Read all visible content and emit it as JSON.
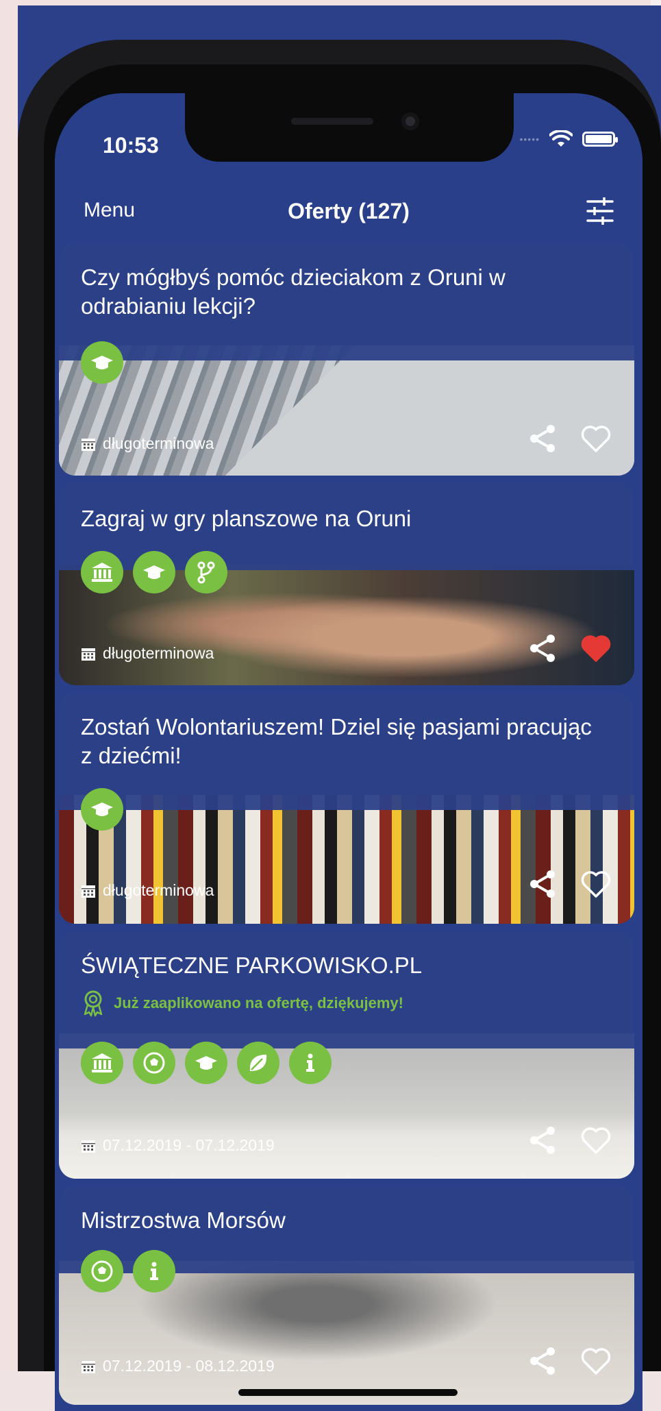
{
  "status": {
    "time": "10:53"
  },
  "nav": {
    "menu": "Menu",
    "title": "Oferty (127)"
  },
  "offers": [
    {
      "title": "Czy mógłbyś pomóc dzieciakom z Oruni w odrabianiu lekcji?",
      "badges": [
        "graduation-cap-icon"
      ],
      "footer": "długoterminowa",
      "liked": false
    },
    {
      "title": "Zagraj w gry planszowe na Oruni",
      "badges": [
        "institution-icon",
        "graduation-cap-icon",
        "branch-icon"
      ],
      "footer": "długoterminowa",
      "liked": true
    },
    {
      "title": "Zostań Wolontariuszem! Dziel się pasjami pracując z dziećmi!",
      "badges": [
        "graduation-cap-icon"
      ],
      "footer": "długoterminowa",
      "liked": false
    },
    {
      "title": "ŚWIĄTECZNE PARKOWISKO.PL",
      "applied": "Już zaaplikowano na ofertę, dziękujemy!",
      "badges": [
        "institution-icon",
        "soccer-ball-icon",
        "graduation-cap-icon",
        "leaf-icon",
        "info-icon"
      ],
      "footer": "07.12.2019 - 07.12.2019",
      "liked": false
    },
    {
      "title": "Mistrzostwa Morsów",
      "badges": [
        "soccer-ball-icon",
        "info-icon"
      ],
      "footer": "07.12.2019 - 08.12.2019",
      "liked": false
    }
  ],
  "colors": {
    "primary": "#2a3f8a",
    "accent": "#7ac043",
    "like": "#e53935"
  }
}
